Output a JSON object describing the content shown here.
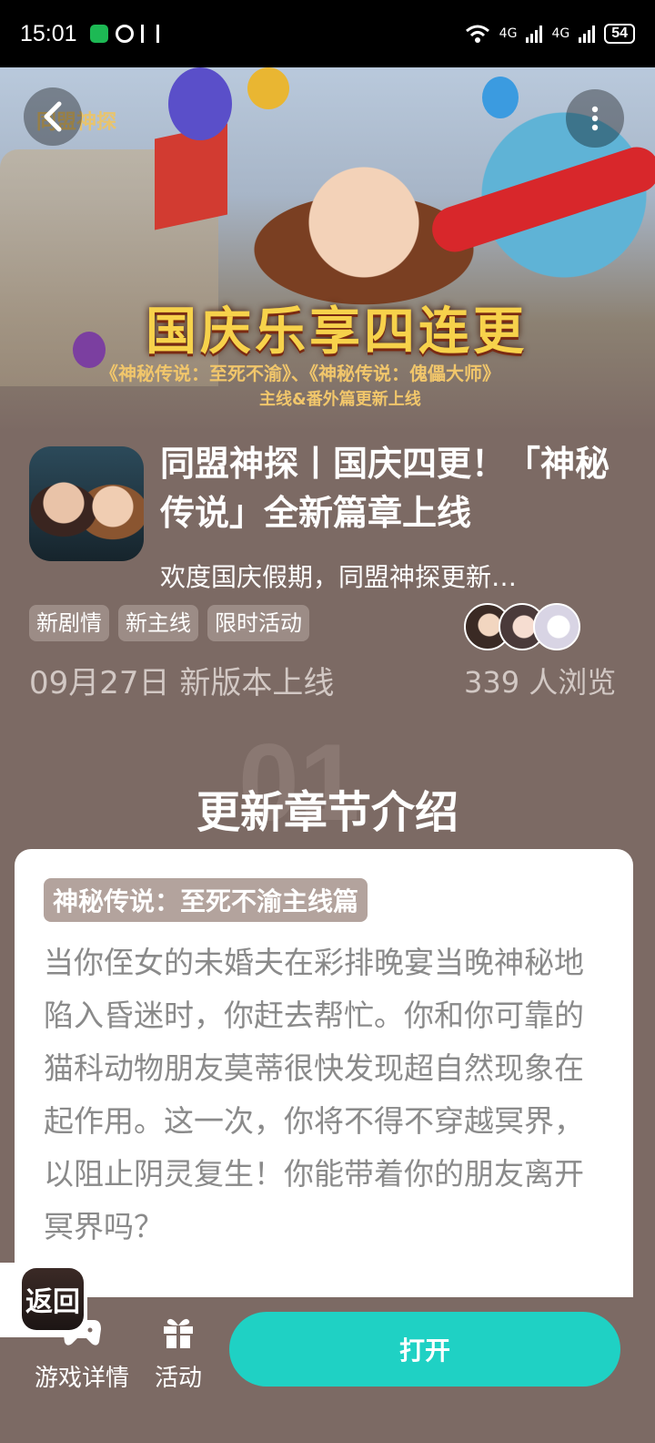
{
  "status_bar": {
    "time": "15:01",
    "network1": "4G",
    "network2": "4G",
    "battery": "54"
  },
  "hero": {
    "logo_text": "同盟神探",
    "banner_title": "国庆乐享四连更",
    "banner_sub": "《神秘传说：至死不渝》、《神秘传说：傀儡大师》",
    "banner_sub2": "主线&番外篇更新上线"
  },
  "header": {
    "title": "同盟神探丨国庆四更！「神秘传说」全新篇章上线",
    "subtitle": "欢度国庆假期，同盟神探更新…"
  },
  "tags": [
    "新剧情",
    "新主线",
    "限时活动"
  ],
  "meta": {
    "date": "09月27日 新版本上线",
    "views": "339 人浏览"
  },
  "section": {
    "number": "01",
    "title": "更新章节介绍"
  },
  "card": {
    "chapter_tag": "神秘传说：至死不渝主线篇",
    "body": "当你侄女的未婚夫在彩排晚宴当晚神秘地陷入昏迷时，你赶去帮忙。你和你可靠的猫科动物朋友莫蒂很快发现超自然现象在起作用。这一次，你将不得不穿越冥界，以阻止阴灵复生！你能带着你的朋友离开冥界吗？"
  },
  "float_back": {
    "label": "返回"
  },
  "bottom_nav": {
    "details_label": "游戏详情",
    "activity_label": "活动",
    "open_label": "打开"
  },
  "colors": {
    "background": "#7c6a64",
    "accent": "#1fd1c4",
    "tag": "#9c8c86"
  }
}
